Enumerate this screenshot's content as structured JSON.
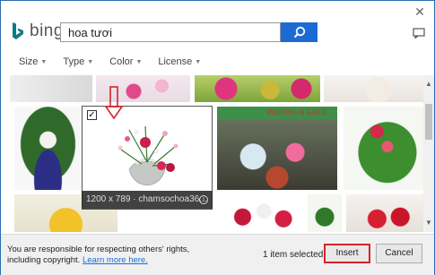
{
  "app": {
    "logo_text": "bing"
  },
  "search": {
    "value": "hoa tươi"
  },
  "filters": [
    {
      "label": "Size"
    },
    {
      "label": "Type"
    },
    {
      "label": "Color"
    },
    {
      "label": "License"
    }
  ],
  "selected_image": {
    "caption": "1200 x 789 · chamsochoa36..."
  },
  "footer": {
    "notice_text": "You are responsible for respecting others' rights, including copyright.",
    "learn_more": "Learn more here.",
    "count_text": "1 item selected.",
    "insert_label": "Insert",
    "cancel_label": "Cancel"
  },
  "image_text": {
    "shop_banner": "PHƯỢNG & KHUÊ"
  },
  "colors": {
    "accent": "#1c6bd4",
    "highlight": "#d3242b"
  }
}
